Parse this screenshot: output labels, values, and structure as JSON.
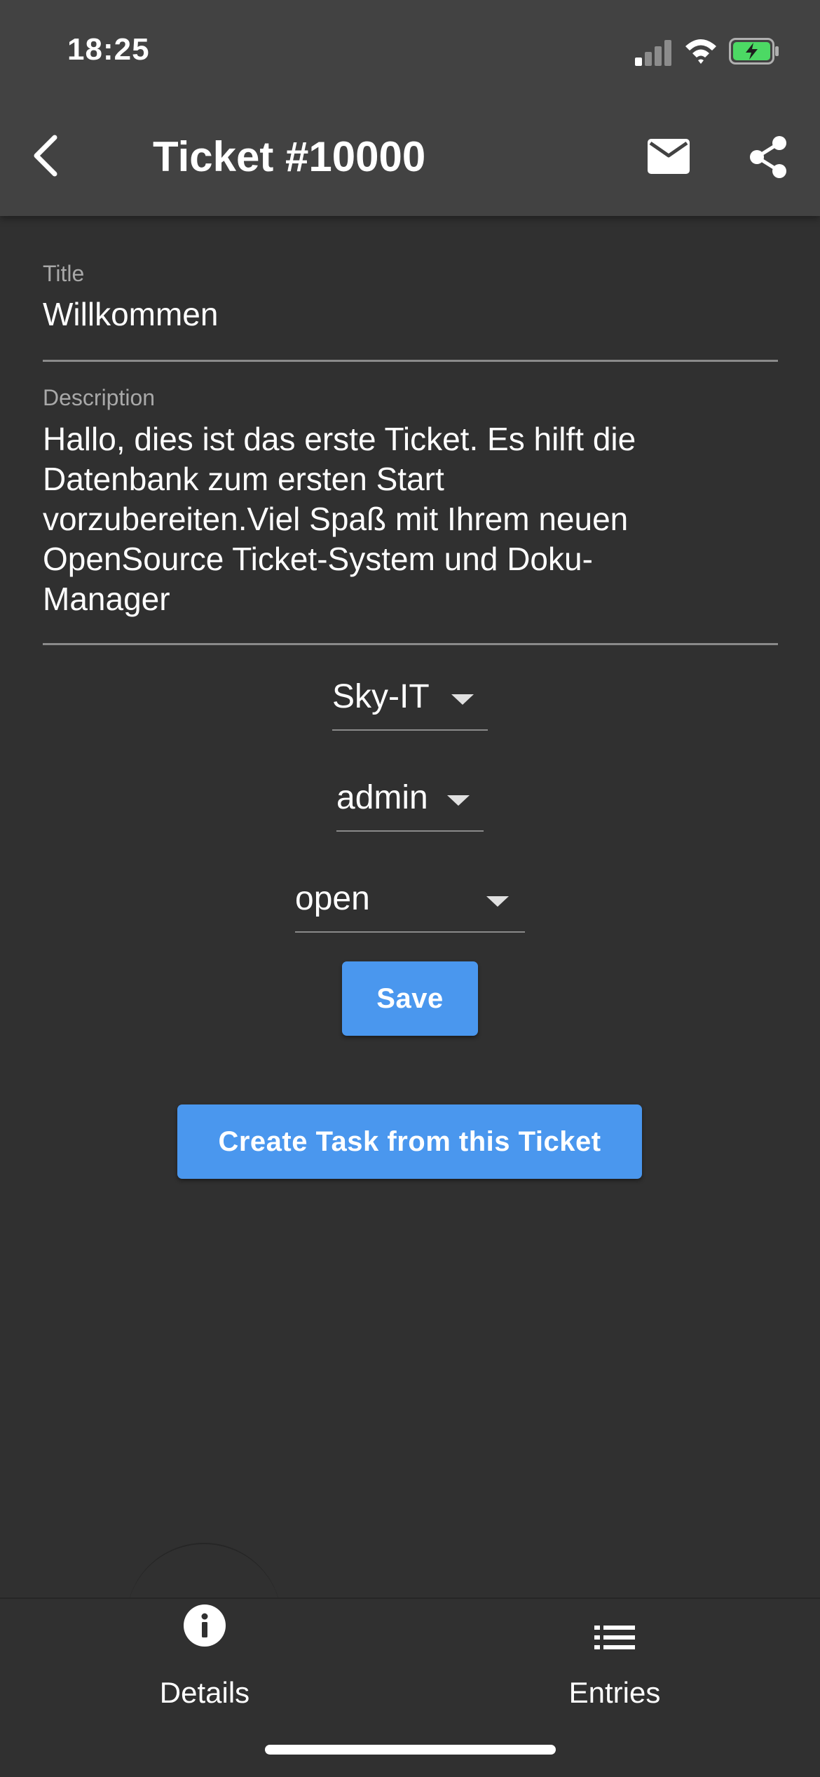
{
  "status_bar": {
    "time": "18:25"
  },
  "app_bar": {
    "title": "Ticket #10000"
  },
  "form": {
    "title_label": "Title",
    "title_value": "Willkommen",
    "description_label": "Description",
    "description_lines": [
      "Hallo, dies ist das erste Ticket. Es hilft die",
      "Datenbank zum ersten Start",
      "vorzubereiten.Viel Spaß mit Ihrem neuen",
      "OpenSource Ticket-System und Doku-",
      "Manager"
    ],
    "customer_value": "Sky-IT",
    "user_value": "admin",
    "status_value": "open",
    "save_label": "Save",
    "create_task_label": "Create Task from this Ticket"
  },
  "bottom_nav": {
    "items": [
      {
        "label": "Details",
        "icon": "info-icon"
      },
      {
        "label": "Entries",
        "icon": "list-icon"
      }
    ]
  },
  "colors": {
    "background": "#303030",
    "app_bar": "#424242",
    "accent": "#4a97ee",
    "battery": "#4cd964"
  }
}
